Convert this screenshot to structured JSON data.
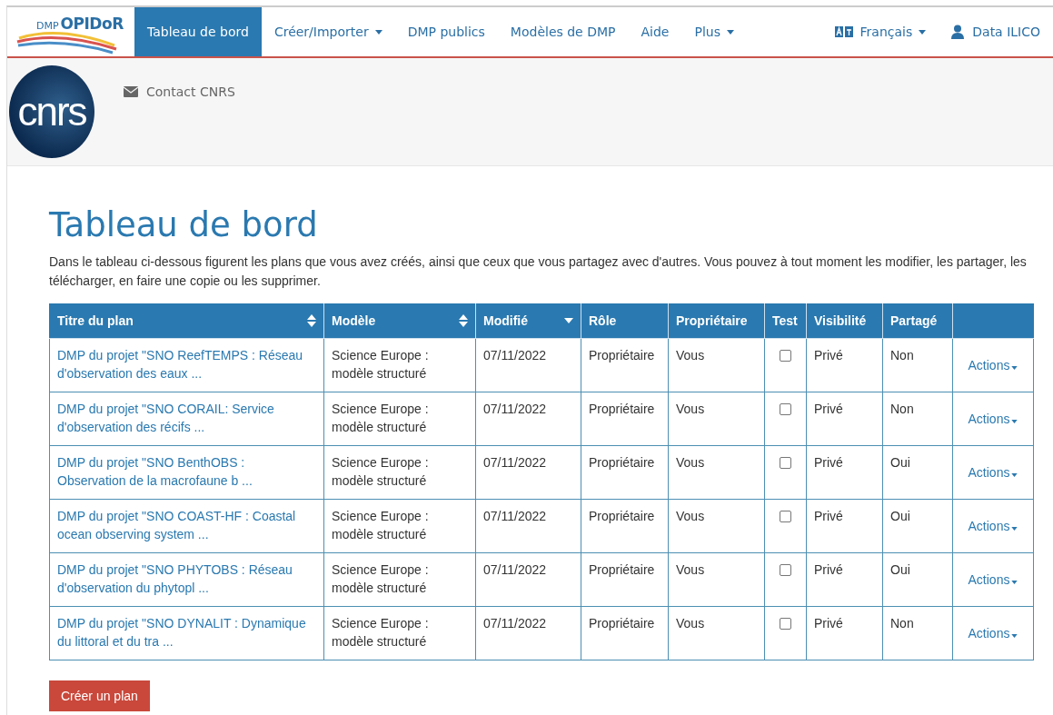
{
  "navbar": {
    "logo": {
      "small": "DMP",
      "large": "OPIDoR"
    },
    "items": [
      {
        "label": "Tableau de bord",
        "selected": true,
        "dropdown": false
      },
      {
        "label": "Créer/Importer",
        "selected": false,
        "dropdown": true
      },
      {
        "label": "DMP publics",
        "selected": false,
        "dropdown": false
      },
      {
        "label": "Modèles de DMP",
        "selected": false,
        "dropdown": false
      },
      {
        "label": "Aide",
        "selected": false,
        "dropdown": false
      },
      {
        "label": "Plus",
        "selected": false,
        "dropdown": true
      }
    ],
    "language": "Français",
    "user": "Data ILICO"
  },
  "org_header": {
    "logo_text": "cnrs",
    "contact": "Contact CNRS"
  },
  "title": "Tableau de bord",
  "intro": "Dans le tableau ci-dessous figurent les plans que vous avez créés, ainsi que ceux que vous partagez avec d'autres. Vous pouvez à tout moment les modifier, les partager, les télécharger, en faire une copie ou les supprimer.",
  "table": {
    "columns": [
      {
        "label": "Titre du plan",
        "sortable": true,
        "sorted": false
      },
      {
        "label": "Modèle",
        "sortable": true,
        "sorted": false
      },
      {
        "label": "Modifié",
        "sortable": true,
        "sorted": true
      },
      {
        "label": "Rôle",
        "sortable": false,
        "sorted": false
      },
      {
        "label": "Propriétaire",
        "sortable": false,
        "sorted": false
      },
      {
        "label": "Test",
        "sortable": false,
        "sorted": false
      },
      {
        "label": "Visibilité",
        "sortable": false,
        "sorted": false
      },
      {
        "label": "Partagé",
        "sortable": false,
        "sorted": false
      }
    ],
    "rows": [
      {
        "title": "DMP du projet \"SNO ReefTEMPS : Réseau d'observation des eaux ...",
        "template": "Science Europe : modèle structuré",
        "modified": "07/11/2022",
        "role": "Propriétaire",
        "owner": "Vous",
        "test": false,
        "visibility": "Privé",
        "shared": "Non",
        "action": "Actions"
      },
      {
        "title": "DMP du projet \"SNO CORAIL: Service d'observation des récifs ...",
        "template": "Science Europe : modèle structuré",
        "modified": "07/11/2022",
        "role": "Propriétaire",
        "owner": "Vous",
        "test": false,
        "visibility": "Privé",
        "shared": "Non",
        "action": "Actions"
      },
      {
        "title": "DMP du projet \"SNO BenthOBS : Observation de la macrofaune b ...",
        "template": "Science Europe : modèle structuré",
        "modified": "07/11/2022",
        "role": "Propriétaire",
        "owner": "Vous",
        "test": false,
        "visibility": "Privé",
        "shared": "Oui",
        "action": "Actions"
      },
      {
        "title": "DMP du projet \"SNO COAST-HF : Coastal ocean observing system ...",
        "template": "Science Europe : modèle structuré",
        "modified": "07/11/2022",
        "role": "Propriétaire",
        "owner": "Vous",
        "test": false,
        "visibility": "Privé",
        "shared": "Oui",
        "action": "Actions"
      },
      {
        "title": "DMP du projet \"SNO PHYTOBS : Réseau d'observation du phytopl ...",
        "template": "Science Europe : modèle structuré",
        "modified": "07/11/2022",
        "role": "Propriétaire",
        "owner": "Vous",
        "test": false,
        "visibility": "Privé",
        "shared": "Oui",
        "action": "Actions"
      },
      {
        "title": "DMP du projet \"SNO DYNALIT : Dynamique du littoral et du tra ...",
        "template": "Science Europe : modèle structuré",
        "modified": "07/11/2022",
        "role": "Propriétaire",
        "owner": "Vous",
        "test": false,
        "visibility": "Privé",
        "shared": "Non",
        "action": "Actions"
      }
    ]
  },
  "create_button": "Créer un plan"
}
